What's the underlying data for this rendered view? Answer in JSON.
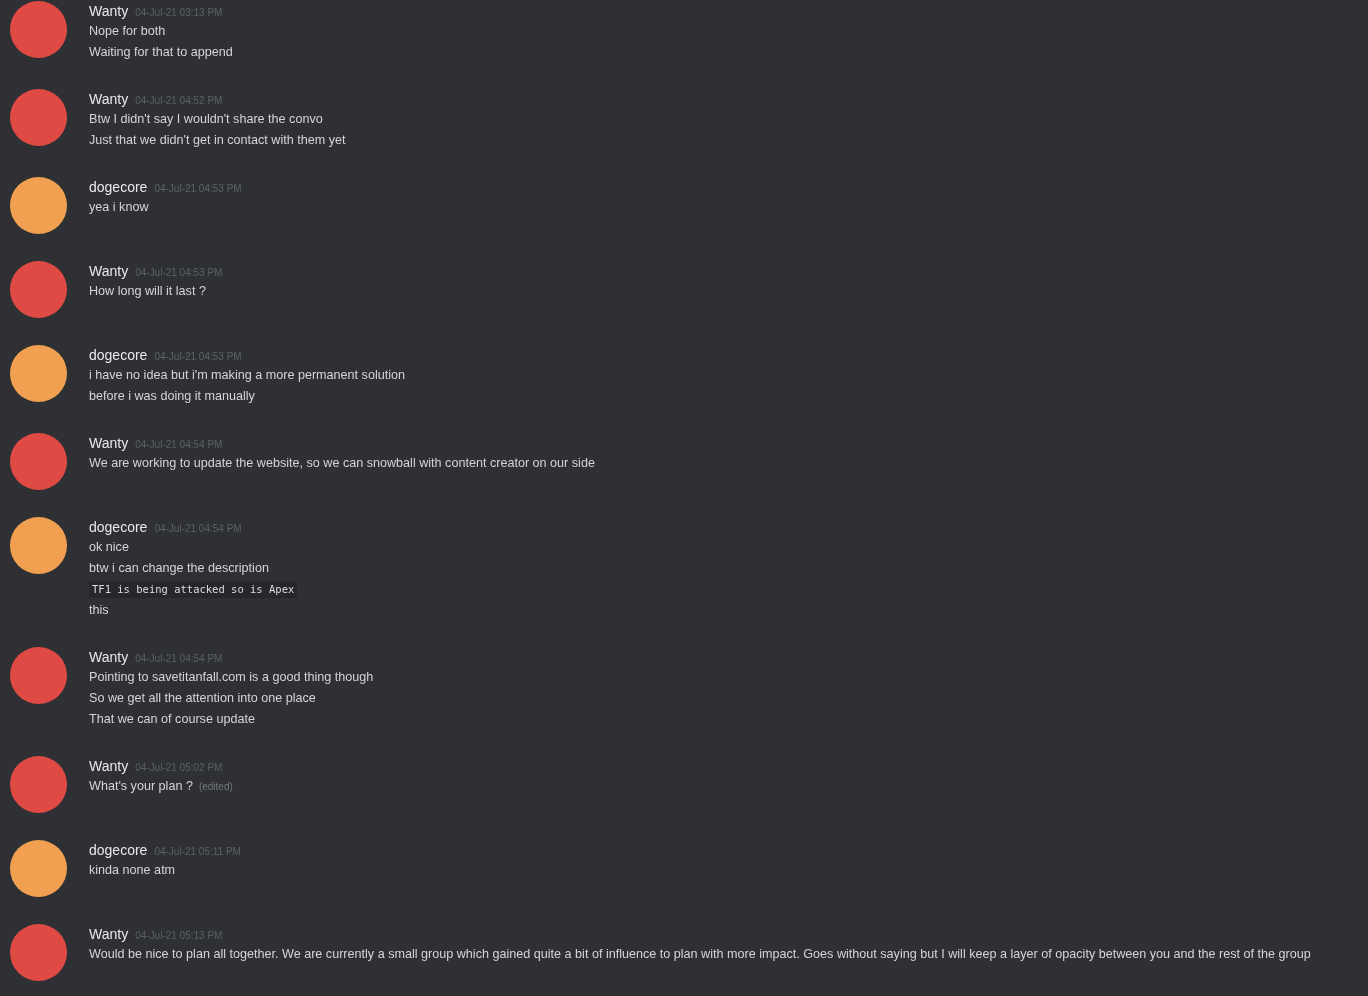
{
  "messages": [
    {
      "author": "Wanty",
      "color": "#e04a44",
      "timestamp": "04-Jul-21 03:13 PM",
      "lines": [
        {
          "kind": "text",
          "text": "Nope for both"
        },
        {
          "kind": "text",
          "text": "Waiting for that to append"
        }
      ]
    },
    {
      "author": "Wanty",
      "color": "#e04a44",
      "timestamp": "04-Jul-21 04:52 PM",
      "lines": [
        {
          "kind": "text",
          "text": "Btw I didn't say I wouldn't share the convo"
        },
        {
          "kind": "text",
          "text": "Just that we didn't get in contact with them yet"
        }
      ]
    },
    {
      "author": "dogecore",
      "color": "#f0a050",
      "timestamp": "04-Jul-21 04:53 PM",
      "lines": [
        {
          "kind": "text",
          "text": "yea i know"
        }
      ]
    },
    {
      "author": "Wanty",
      "color": "#e04a44",
      "timestamp": "04-Jul-21 04:53 PM",
      "lines": [
        {
          "kind": "text",
          "text": "How long will it last ?"
        }
      ]
    },
    {
      "author": "dogecore",
      "color": "#f0a050",
      "timestamp": "04-Jul-21 04:53 PM",
      "lines": [
        {
          "kind": "text",
          "text": "i have no idea but i'm making a more permanent solution"
        },
        {
          "kind": "text",
          "text": "before i was doing it manually"
        }
      ]
    },
    {
      "author": "Wanty",
      "color": "#e04a44",
      "timestamp": "04-Jul-21 04:54 PM",
      "lines": [
        {
          "kind": "text",
          "text": "We are working to update the website, so we can snowball with content creator on our side"
        }
      ]
    },
    {
      "author": "dogecore",
      "color": "#f0a050",
      "timestamp": "04-Jul-21 04:54 PM",
      "lines": [
        {
          "kind": "text",
          "text": "ok nice"
        },
        {
          "kind": "text",
          "text": "btw i can change the description"
        },
        {
          "kind": "code",
          "text": "TF1 is being attacked so is Apex"
        },
        {
          "kind": "text",
          "text": "this"
        }
      ]
    },
    {
      "author": "Wanty",
      "color": "#e04a44",
      "timestamp": "04-Jul-21 04:54 PM",
      "lines": [
        {
          "kind": "text",
          "text": "Pointing to savetitanfall.com is a good thing though"
        },
        {
          "kind": "text",
          "text": "So we get all the attention into one place"
        },
        {
          "kind": "text",
          "text": "That we can of course update"
        }
      ]
    },
    {
      "author": "Wanty",
      "color": "#e04a44",
      "timestamp": "04-Jul-21 05:02 PM",
      "lines": [
        {
          "kind": "text",
          "text": "What's your plan ?",
          "edited": "(edited)"
        }
      ]
    },
    {
      "author": "dogecore",
      "color": "#f0a050",
      "timestamp": "04-Jul-21 05:11 PM",
      "lines": [
        {
          "kind": "text",
          "text": "kinda none atm"
        }
      ]
    },
    {
      "author": "Wanty",
      "color": "#e04a44",
      "timestamp": "04-Jul-21 05:13 PM",
      "lines": [
        {
          "kind": "text",
          "text": "Would be nice to plan all together. We are currently a small group which gained quite a bit of influence to plan with more impact. Goes without saying but I will keep a layer of opacity between you and the rest of the group"
        }
      ]
    }
  ]
}
